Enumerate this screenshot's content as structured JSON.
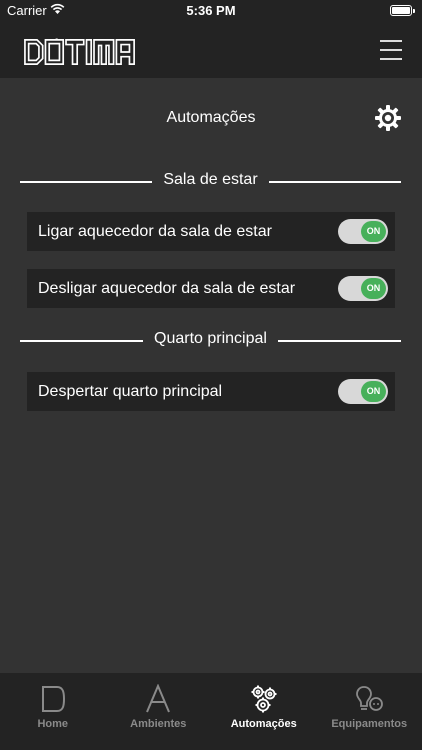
{
  "status_bar": {
    "carrier": "Carrier",
    "time": "5:36 PM",
    "wifi_icon": "wifi-icon",
    "battery_level": 1.0
  },
  "header": {
    "logo_text": "ÓTIMA",
    "menu_icon": "hamburger-menu-icon"
  },
  "page": {
    "title": "Automações",
    "settings_icon": "gear-icon"
  },
  "sections": [
    {
      "title": "Sala de estar",
      "items": [
        {
          "label": "Ligar aquecedor da sala de estar",
          "toggle_label": "ON",
          "on": true
        },
        {
          "label": "Desligar aquecedor da sala de estar",
          "toggle_label": "ON",
          "on": true
        }
      ]
    },
    {
      "title": "Quarto principal",
      "items": [
        {
          "label": "Despertar quarto principal",
          "toggle_label": "ON",
          "on": true
        }
      ]
    }
  ],
  "tabs": [
    {
      "label": "Home",
      "icon": "home-icon",
      "active": false
    },
    {
      "label": "Ambientes",
      "icon": "letter-a-icon",
      "active": false
    },
    {
      "label": "Automações",
      "icon": "gears-icon",
      "active": true
    },
    {
      "label": "Equipamentos",
      "icon": "lightbulb-plug-icon",
      "active": false
    }
  ],
  "colors": {
    "background": "#333333",
    "bar": "#232323",
    "toggle_on": "#47b05a",
    "toggle_track": "#d8d8d8",
    "inactive_tab": "#8a8a8a"
  }
}
